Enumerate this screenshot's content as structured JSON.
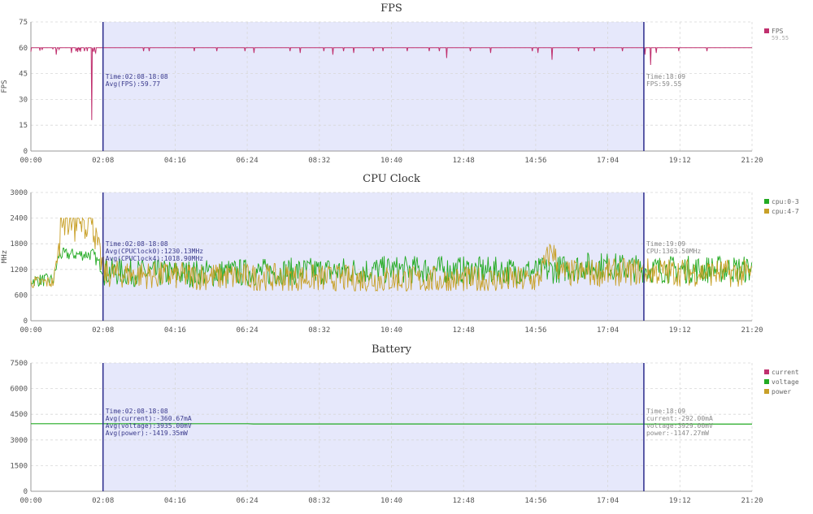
{
  "charts": [
    {
      "title": "FPS",
      "ylabel": "FPS",
      "yticks": [
        "0",
        "15",
        "30",
        "45",
        "60",
        "75"
      ],
      "xticks": [
        "00:00",
        "02:08",
        "04:16",
        "06:24",
        "08:32",
        "10:40",
        "12:48",
        "14:56",
        "17:04",
        "19:12",
        "21:20"
      ],
      "legend": [
        {
          "name": "FPS",
          "color": "#c0306e",
          "sub": "59.55"
        }
      ],
      "annotation_left": [
        "Time:02:08-18:08",
        "Avg(FPS):59.77"
      ],
      "annotation_right": [
        "Time:18:09",
        "FPS:59.55"
      ]
    },
    {
      "title": "CPU Clock",
      "ylabel": "MHz",
      "yticks": [
        "0",
        "600",
        "1200",
        "1800",
        "2400",
        "3000"
      ],
      "xticks": [
        "00:00",
        "02:08",
        "04:16",
        "06:24",
        "08:32",
        "10:40",
        "12:48",
        "14:56",
        "17:04",
        "19:12",
        "21:20"
      ],
      "legend": [
        {
          "name": "cpu:0-3",
          "color": "#22aa22"
        },
        {
          "name": "cpu:4-7",
          "color": "#c8a028"
        }
      ],
      "annotation_left": [
        "Time:02:08-18:08",
        "Avg(CPUClock0):1230.13MHz",
        "Avg(CPUClock4):1018.90MHz"
      ],
      "annotation_right": [
        "Time:19:09",
        "CPU:1363.50MHz"
      ]
    },
    {
      "title": "Battery",
      "ylabel": "",
      "yticks": [
        "0",
        "1500",
        "3000",
        "4500",
        "6000",
        "7500"
      ],
      "xticks": [
        "00:00",
        "02:08",
        "04:16",
        "06:24",
        "08:32",
        "10:40",
        "12:48",
        "14:56",
        "17:04",
        "19:12",
        "21:20"
      ],
      "legend": [
        {
          "name": "current",
          "color": "#c0306e"
        },
        {
          "name": "voltage",
          "color": "#22aa22"
        },
        {
          "name": "power",
          "color": "#c8a028"
        }
      ],
      "annotation_left": [
        "Time:02:08-18:08",
        "Avg(current):-360.67mA",
        "Avg(voltage):3935.00mV",
        "Avg(power):-1419.35mW"
      ],
      "annotation_right": [
        "Time:18:09",
        "current:-292.00mA",
        "voltage:3929.00mV",
        "power:-1147.27mW"
      ]
    }
  ],
  "chart_data": [
    {
      "type": "line",
      "title": "FPS",
      "xlabel": "",
      "ylabel": "FPS",
      "xlim_seconds": [
        0,
        1280
      ],
      "ylim": [
        0,
        75
      ],
      "selection_range": [
        "02:08",
        "18:08"
      ],
      "series": [
        {
          "name": "FPS",
          "baseline": 60,
          "dips": [
            [
              45,
              56
            ],
            [
              50,
              59
            ],
            [
              72,
              57
            ],
            [
              95,
              58
            ],
            [
              100,
              58
            ],
            [
              108,
              18
            ],
            [
              115,
              57
            ],
            [
              200,
              58
            ],
            [
              210,
              58
            ],
            [
              290,
              58
            ],
            [
              330,
              58
            ],
            [
              380,
              58
            ],
            [
              396,
              57
            ],
            [
              460,
              58
            ],
            [
              478,
              57
            ],
            [
              520,
              58
            ],
            [
              536,
              56
            ],
            [
              555,
              58
            ],
            [
              573,
              57
            ],
            [
              608,
              58
            ],
            [
              625,
              58
            ],
            [
              668,
              58
            ],
            [
              707,
              58
            ],
            [
              725,
              58
            ],
            [
              738,
              54
            ],
            [
              780,
              58
            ],
            [
              816,
              57
            ],
            [
              890,
              58
            ],
            [
              900,
              57
            ],
            [
              925,
              53
            ],
            [
              972,
              58
            ],
            [
              1000,
              58
            ],
            [
              1050,
              58
            ],
            [
              1090,
              56
            ],
            [
              1100,
              50
            ],
            [
              1110,
              57
            ],
            [
              1150,
              58
            ],
            [
              1200,
              58
            ]
          ]
        }
      ]
    },
    {
      "type": "line",
      "title": "CPU Clock",
      "xlabel": "",
      "ylabel": "MHz",
      "xlim_seconds": [
        0,
        1280
      ],
      "ylim": [
        0,
        3000
      ],
      "selection_range": [
        "02:08",
        "18:08"
      ],
      "series": [
        {
          "name": "cpu:0-3",
          "profile": [
            [
              0,
              950
            ],
            [
              40,
              950
            ],
            [
              50,
              1550
            ],
            [
              110,
              1550
            ],
            [
              130,
              1150
            ],
            [
              250,
              1100
            ],
            [
              700,
              1200
            ],
            [
              900,
              1150
            ],
            [
              1000,
              1300
            ],
            [
              1100,
              1200
            ],
            [
              1280,
              1200
            ]
          ]
        },
        {
          "name": "cpu:4-7",
          "profile": [
            [
              0,
              900
            ],
            [
              40,
              900
            ],
            [
              55,
              2200
            ],
            [
              110,
              2200
            ],
            [
              130,
              1100
            ],
            [
              250,
              1050
            ],
            [
              700,
              950
            ],
            [
              900,
              950
            ],
            [
              925,
              1700
            ],
            [
              940,
              1100
            ],
            [
              1100,
              1150
            ],
            [
              1280,
              1100
            ]
          ]
        }
      ]
    },
    {
      "type": "line",
      "title": "Battery",
      "xlabel": "",
      "ylabel": "",
      "xlim_seconds": [
        0,
        1280
      ],
      "ylim": [
        0,
        7500
      ],
      "selection_range": [
        "02:08",
        "18:08"
      ],
      "series": [
        {
          "name": "voltage",
          "points": [
            [
              0,
              3950
            ],
            [
              385,
              3950
            ],
            [
              395,
              3935
            ],
            [
              1280,
              3929
            ]
          ]
        },
        {
          "name": "current",
          "points": []
        },
        {
          "name": "power",
          "points": []
        }
      ]
    }
  ]
}
